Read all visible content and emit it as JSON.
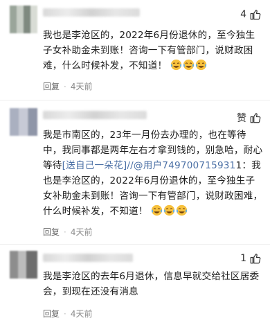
{
  "comments": [
    {
      "like_count": "4",
      "text_1": "我也是李沧区的，2022年6月份退休的，至今独生子女补助金未到账！咨询一下有管部门，说财政困难，什么时候补发，不知道！",
      "reply_label": "回复",
      "time": "4天前"
    },
    {
      "like_count": "赞",
      "text_1": "我是市南区的，23年一月份去办理的，也在等待中，我同事都是两年左右才拿到钱的，别急哈，耐心等待",
      "link_text": "[送自己一朵花]//@用户749700715931",
      "text_2": "1：我也是李沧区的，2022年6月份退休的，至今独生子女补助金未到账！咨询一下有管部门，说财政困难，什么时候补发，不知道！",
      "reply_label": "回复",
      "time": "4天前"
    },
    {
      "like_count": "1",
      "text_1": "我是李沧区的去年6月退休，信息早就交给社区居委会，到现在还没有消息",
      "reply_label": "回复",
      "time": "4天前"
    }
  ],
  "icons": {
    "thumb": "thumbs-up-icon",
    "emoji": "crying-laughing-emoji"
  }
}
